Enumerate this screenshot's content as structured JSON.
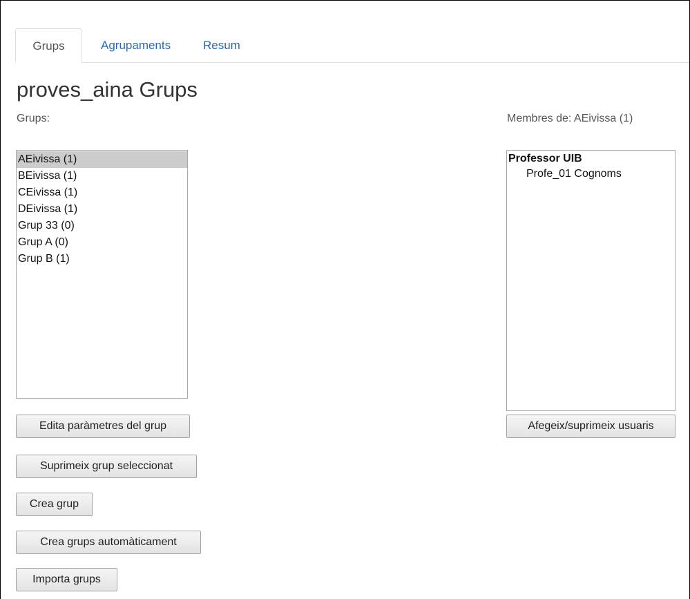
{
  "tabs": [
    {
      "label": "Grups",
      "active": true
    },
    {
      "label": "Agrupaments",
      "active": false
    },
    {
      "label": "Resum",
      "active": false
    }
  ],
  "page_title": "proves_aina Grups",
  "groups_label": "Grups:",
  "members_label": "Membres de: AEivissa (1)",
  "groups": [
    {
      "label": "AEivissa (1)",
      "selected": true
    },
    {
      "label": "BEivissa (1)",
      "selected": false
    },
    {
      "label": "CEivissa (1)",
      "selected": false
    },
    {
      "label": "DEivissa (1)",
      "selected": false
    },
    {
      "label": "Grup 33 (0)",
      "selected": false
    },
    {
      "label": "Grup A (0)",
      "selected": false
    },
    {
      "label": "Grup B (1)",
      "selected": false
    }
  ],
  "members": {
    "role": "Professor UIB",
    "people": [
      "Profe_01 Cognoms"
    ]
  },
  "buttons": {
    "edit": "Edita paràmetres del grup",
    "delete": "Suprimeix grup seleccionat",
    "create": "Crea grup",
    "auto": "Crea grups automàticament",
    "import": "Importa grups",
    "members": "Afegeix/suprimeix usuaris"
  },
  "colors": {
    "link": "#2a6ab3",
    "selected_option": "#cccccc"
  }
}
